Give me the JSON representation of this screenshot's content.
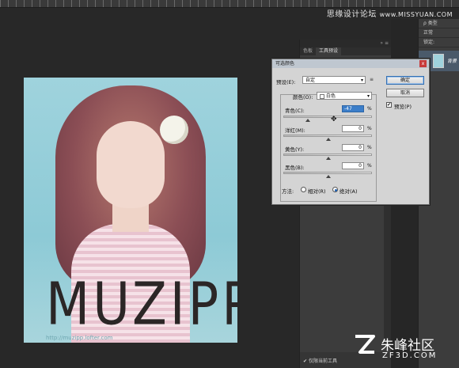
{
  "watermark_top": {
    "cn": "思缘设计论坛",
    "site": "www.MISSYUAN.COM"
  },
  "canvas": {
    "muzipp_text": "MUZIPP",
    "url_mark": "http://muzipp.lofter.com"
  },
  "panels": {
    "tab1": "色板",
    "tab2": "工具预设",
    "footer_check": "✔",
    "footer_label": "仅限当前工具"
  },
  "layers": {
    "kind": "ρ 类型",
    "mode": "正常",
    "lock": "锁定:",
    "layer_name": "背景"
  },
  "dialog": {
    "title": "可选颜色",
    "close": "x",
    "preset_label": "预设(E):",
    "preset_value": "自定",
    "colors_label": "颜色(O):",
    "colors_value": "白色",
    "cyan_label": "青色(C):",
    "cyan_value": "-47",
    "magenta_label": "洋红(M):",
    "magenta_value": "0",
    "yellow_label": "黄色(Y):",
    "yellow_value": "0",
    "black_label": "黑色(B):",
    "black_value": "0",
    "percent": "%",
    "method_label": "方法:",
    "relative_label": "相对(R)",
    "absolute_label": "绝对(A)",
    "ok_label": "确定",
    "cancel_label": "取消",
    "preview_label": "预览(P)",
    "preview_checked": "✔",
    "menu_icon": "≡",
    "cursor_icon": "✥"
  },
  "sliders": {
    "cyan": 0.265,
    "magenta": 0.5,
    "yellow": 0.5,
    "black": 0.5
  },
  "logo": {
    "name": "朱峰社区",
    "site": "ZF3D.COM"
  }
}
